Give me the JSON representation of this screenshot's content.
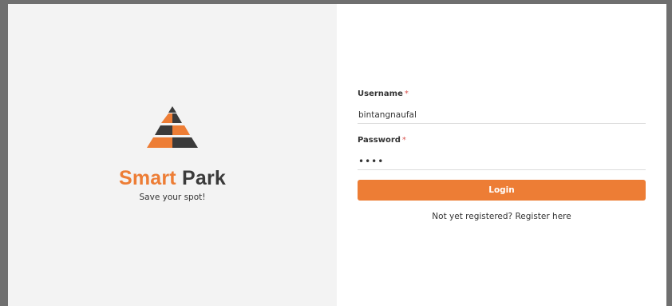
{
  "brand": {
    "logo_icon": "pyramid-logo-icon",
    "name_part1": "Smart",
    "name_part2": "Park",
    "tagline": "Save your spot!"
  },
  "colors": {
    "accent": "#ed7d35",
    "dark": "#3a3a3a",
    "left_bg": "#f3f3f3",
    "right_bg": "#ffffff"
  },
  "form": {
    "username": {
      "label": "Username",
      "required_marker": "*",
      "value": "bintangnaufal"
    },
    "password": {
      "label": "Password",
      "required_marker": "*",
      "value": "••••"
    },
    "login_label": "Login",
    "register_prompt": "Not yet registered?",
    "register_link": "Register here"
  }
}
